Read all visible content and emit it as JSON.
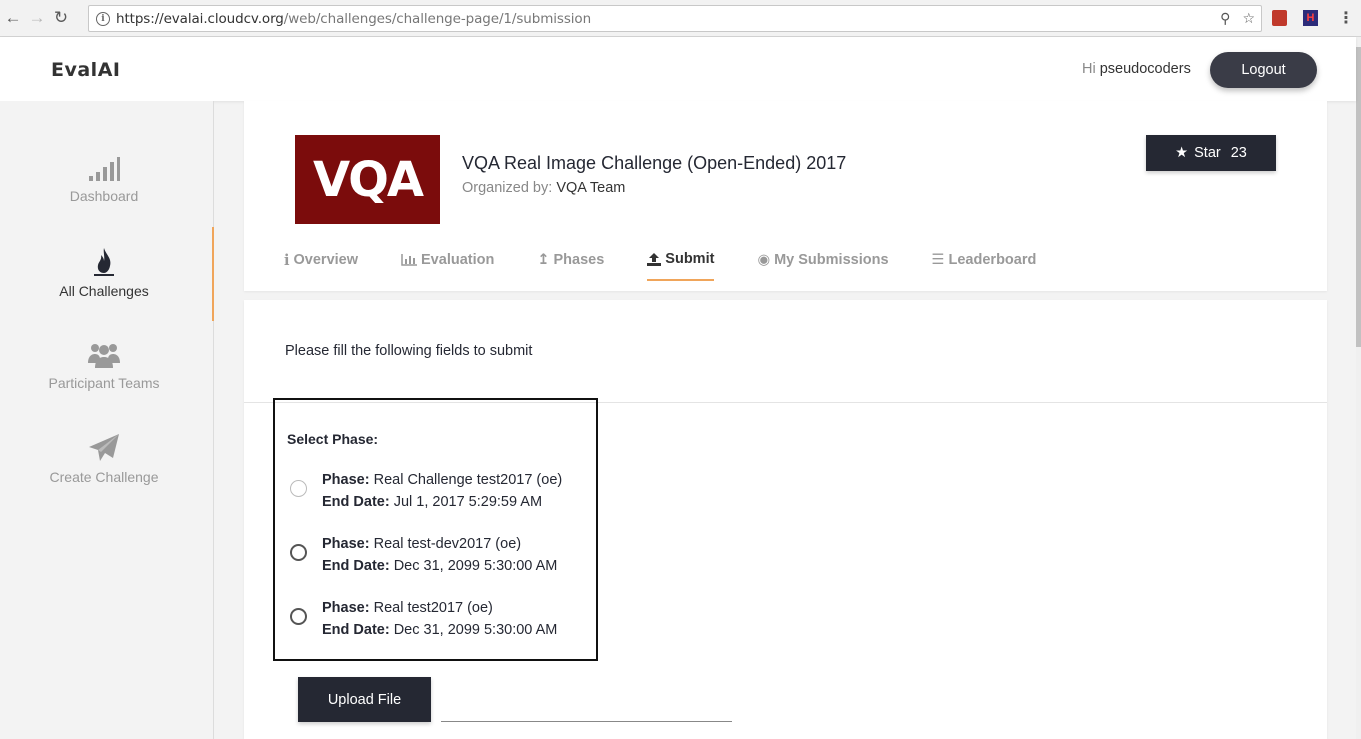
{
  "browser": {
    "url_host": "https://evalai.cloudcv.org",
    "url_path": "/web/challenges/challenge-page/1/submission"
  },
  "header": {
    "logo": "EvalAI",
    "greeting": "Hi",
    "username": "pseudocoders",
    "logout_label": "Logout"
  },
  "sidebar": {
    "items": [
      {
        "label": "Dashboard",
        "icon": "signal-bars-icon"
      },
      {
        "label": "All Challenges",
        "icon": "flame-icon"
      },
      {
        "label": "Participant Teams",
        "icon": "users-icon"
      },
      {
        "label": "Create Challenge",
        "icon": "paper-plane-icon"
      }
    ],
    "active_index": 1
  },
  "challenge": {
    "logo_text": "VQA",
    "title": "VQA Real Image Challenge (Open-Ended) 2017",
    "organized_by_label": "Organized by:",
    "organizer": "VQA Team",
    "star_label": "Star",
    "star_count": "23"
  },
  "tabs": [
    {
      "label": "Overview",
      "icon": "info-icon"
    },
    {
      "label": "Evaluation",
      "icon": "bar-chart-icon"
    },
    {
      "label": "Phases",
      "icon": "arrow-up-icon"
    },
    {
      "label": "Submit",
      "icon": "upload-icon",
      "active": true
    },
    {
      "label": "My Submissions",
      "icon": "eye-icon"
    },
    {
      "label": "Leaderboard",
      "icon": "list-icon"
    }
  ],
  "submission": {
    "instruction": "Please fill the following fields to submit",
    "select_phase_label": "Select Phase:",
    "phase_label": "Phase:",
    "end_date_label": "End Date:",
    "phases": [
      {
        "name": "Real Challenge test2017 (oe)",
        "end_date": "Jul 1, 2017 5:29:59 AM",
        "enabled": false
      },
      {
        "name": "Real test-dev2017 (oe)",
        "end_date": "Dec 31, 2099 5:30:00 AM",
        "enabled": true
      },
      {
        "name": "Real test2017 (oe)",
        "end_date": "Dec 31, 2099 5:30:00 AM",
        "enabled": true
      }
    ],
    "upload_label": "Upload File"
  },
  "colors": {
    "accent": "#f0a55a",
    "dark": "#252833",
    "vqa_brand": "#7b0c0c"
  }
}
